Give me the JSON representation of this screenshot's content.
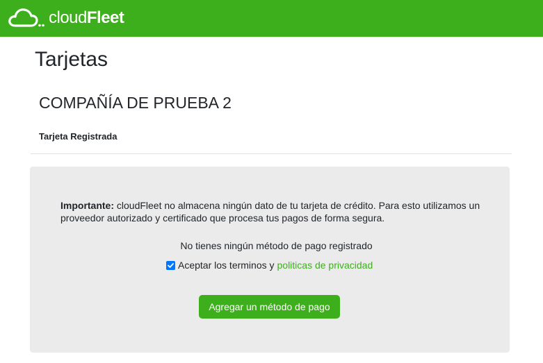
{
  "header": {
    "logo_thin": "cloud",
    "logo_bold": "Fleet",
    "logo_icon": "cloud-logo-icon",
    "background_color": "#3daf1c"
  },
  "page": {
    "title": "Tarjetas",
    "company_name": "COMPAÑÍA DE PRUEBA 2",
    "card_label": "Tarjeta Registrada"
  },
  "notice": {
    "emphasis": "Importante:",
    "text": " cloudFleet no almacena ningún dato de tu tarjeta de crédito. Para esto utilizamos un proveedor autorizado y certificado que procesa tus pagos de forma segura."
  },
  "payment": {
    "empty_message": "No tienes ningún método de pago registrado",
    "terms_checked": true,
    "terms_text": "Aceptar los terminos y",
    "privacy_link": "politicas de privacidad",
    "add_button_label": "Agregar un método de pago",
    "accent_color": "#3daf1c",
    "panel_color": "#ebebeb"
  }
}
